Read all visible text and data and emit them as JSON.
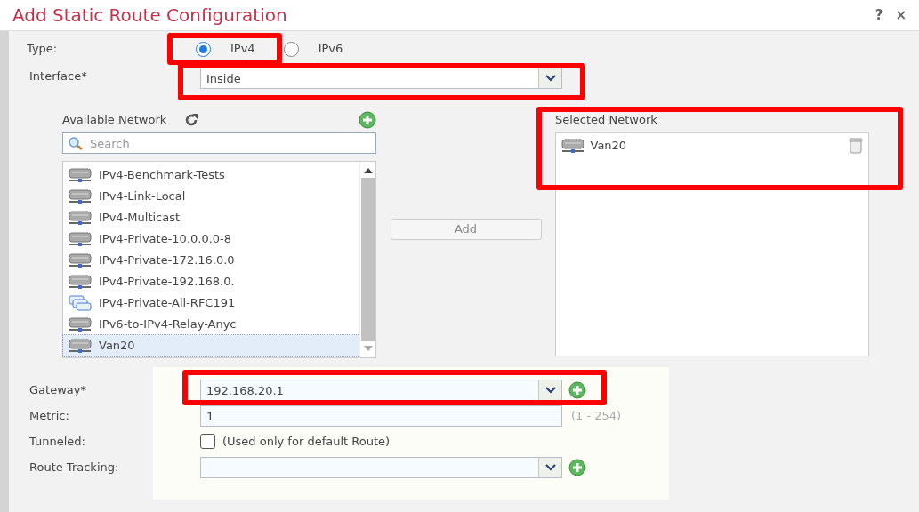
{
  "dialog": {
    "title": "Add Static Route Configuration",
    "help": "?",
    "close": "×"
  },
  "type": {
    "label": "Type:",
    "options": [
      {
        "label": "IPv4",
        "selected": true,
        "highlighted": true
      },
      {
        "label": "IPv6",
        "selected": false,
        "highlighted": false
      }
    ]
  },
  "interface": {
    "label": "Interface*",
    "value": "Inside",
    "highlighted": true
  },
  "available_network": {
    "title": "Available Network",
    "search": {
      "placeholder": "Search"
    },
    "items": [
      {
        "label": "IPv4-Benchmark-Tests",
        "kind": "network",
        "selected": false
      },
      {
        "label": "IPv4-Link-Local",
        "kind": "network",
        "selected": false
      },
      {
        "label": "IPv4-Multicast",
        "kind": "network",
        "selected": false
      },
      {
        "label": "IPv4-Private-10.0.0.0-8",
        "kind": "network",
        "selected": false
      },
      {
        "label": "IPv4-Private-172.16.0.0",
        "kind": "network",
        "selected": false
      },
      {
        "label": "IPv4-Private-192.168.0.",
        "kind": "network",
        "selected": false
      },
      {
        "label": "IPv4-Private-All-RFC191",
        "kind": "group",
        "selected": false
      },
      {
        "label": "IPv6-to-IPv4-Relay-Anyc",
        "kind": "network",
        "selected": false
      },
      {
        "label": "Van20",
        "kind": "network",
        "selected": true
      }
    ]
  },
  "add_button": {
    "label": "Add",
    "disabled": true
  },
  "selected_network": {
    "title": "Selected Network",
    "highlighted": true,
    "items": [
      {
        "label": "Van20",
        "kind": "network"
      }
    ]
  },
  "gateway": {
    "label": "Gateway*",
    "value": "192.168.20.1",
    "highlighted": true
  },
  "metric": {
    "label": "Metric:",
    "value": "1",
    "hint": "(1 - 254)"
  },
  "tunneled": {
    "label": "Tunneled:",
    "checked": false,
    "note": "(Used only for default Route)"
  },
  "route_tracking": {
    "label": "Route Tracking:"
  }
}
